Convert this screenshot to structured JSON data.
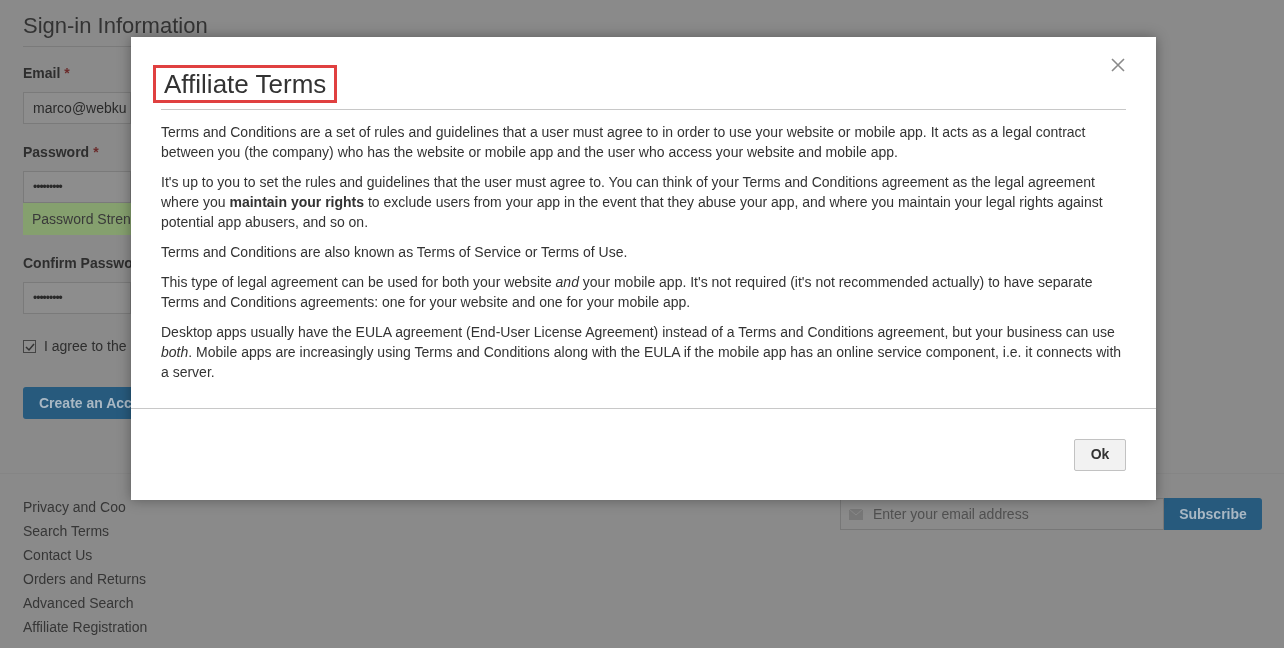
{
  "page": {
    "section_title": "Sign-in Information",
    "fields": [
      {
        "label": "Email",
        "required_mark": "*",
        "value": "marco@webku",
        "kind": "text"
      },
      {
        "label": "Password",
        "required_mark": "*",
        "value": "•••••••••",
        "kind": "password",
        "strength": "Password Stren"
      },
      {
        "label": "Confirm Passwo",
        "value": "•••••••••",
        "kind": "password"
      }
    ],
    "agree": {
      "label": "I agree to the",
      "checked": true
    },
    "submit": "Create an Acc"
  },
  "footer": {
    "links": [
      "Privacy and Coo",
      "Search Terms",
      "Contact Us",
      "Orders and Returns",
      "Advanced Search",
      "Affiliate Registration"
    ],
    "newsletter": {
      "placeholder": "Enter your email address",
      "button": "Subscribe"
    }
  },
  "modal": {
    "title": "Affiliate Terms",
    "title_highlighted": true,
    "paragraphs": [
      "Terms and Conditions are a set of rules and guidelines that a user must agree to in order to use your website or mobile app. It acts as a legal contract between you (the company) who has the website or mobile app and the user who access your website and mobile app.",
      "It's up to you to set the rules and guidelines that the user must agree to. You can think of your Terms and Conditions agreement as the legal agreement where you **maintain your rights** to exclude users from your app in the event that they abuse your app, and where you maintain your legal rights against potential app abusers, and so on.",
      "Terms and Conditions are also known as Terms of Service or Terms of Use.",
      "This type of legal agreement can be used for both your website *and* your mobile app. It's not required (it's not recommended actually) to have separate Terms and Conditions agreements: one for your website and one for your mobile app.",
      "Desktop apps usually have the EULA agreement (End-User License Agreement) instead of a Terms and Conditions agreement, but your business can use *both*. Mobile apps are increasingly using Terms and Conditions along with the EULA if the mobile app has an online service component, i.e. it connects with a server."
    ],
    "ok": "Ok"
  }
}
